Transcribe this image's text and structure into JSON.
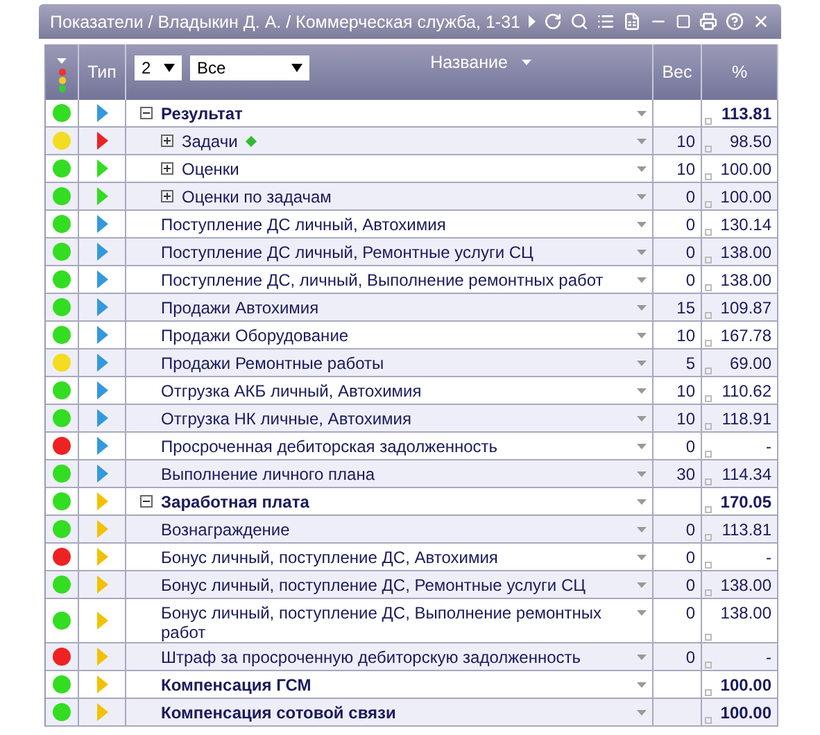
{
  "window": {
    "title": "Показатели / Владыкин Д. А. / Коммерческая служба, 1-31"
  },
  "header": {
    "type_label": "Тип",
    "level_select": "2",
    "filter_select": "Все",
    "name_label": "Название",
    "weight_label": "Вес",
    "percent_label": "%"
  },
  "rows": [
    {
      "kind": "group",
      "name": "Результат",
      "light": {
        "color": "#33dd22"
      },
      "type": {
        "color": "#3399dd"
      },
      "expanded": true,
      "marker": false,
      "percent": "113.81",
      "children": [
        {
          "kind": "item",
          "name": "Задачи",
          "light": {
            "color": "#f2dd22"
          },
          "type": {
            "color": "#ee2222"
          },
          "expanded": false,
          "marker": true,
          "weight": "10",
          "percent": "98.50"
        },
        {
          "kind": "item",
          "name": "Оценки",
          "light": {
            "color": "#33dd22"
          },
          "type": {
            "color": "#33dd22"
          },
          "expanded": false,
          "marker": false,
          "weight": "10",
          "percent": "100.00"
        },
        {
          "kind": "item",
          "name": "Оценки по задачам",
          "light": {
            "color": "#33dd22"
          },
          "type": {
            "color": "#33dd22"
          },
          "expanded": false,
          "marker": false,
          "weight": "0",
          "percent": "100.00"
        }
      ]
    },
    {
      "kind": "item",
      "name": "Поступление ДС личный, Автохимия",
      "light": {
        "color": "#33dd22"
      },
      "type": {
        "color": "#3399dd"
      },
      "marker": false,
      "weight": "0",
      "percent": "130.14"
    },
    {
      "kind": "item",
      "name": "Поступление ДС личный, Ремонтные услуги СЦ",
      "light": {
        "color": "#33dd22"
      },
      "type": {
        "color": "#3399dd"
      },
      "marker": false,
      "weight": "0",
      "percent": "138.00"
    },
    {
      "kind": "item",
      "name": "Поступление ДС, личный, Выполнение ремонтных работ",
      "light": {
        "color": "#33dd22"
      },
      "type": {
        "color": "#3399dd"
      },
      "marker": false,
      "weight": "0",
      "percent": "138.00"
    },
    {
      "kind": "item",
      "name": "Продажи Автохимия",
      "light": {
        "color": "#33dd22"
      },
      "type": {
        "color": "#3399dd"
      },
      "marker": false,
      "weight": "15",
      "percent": "109.87"
    },
    {
      "kind": "item",
      "name": "Продажи Оборудование",
      "light": {
        "color": "#33dd22"
      },
      "type": {
        "color": "#3399dd"
      },
      "marker": false,
      "weight": "10",
      "percent": "167.78"
    },
    {
      "kind": "item",
      "name": "Продажи Ремонтные работы",
      "light": {
        "color": "#f2dd22"
      },
      "type": {
        "color": "#3399dd"
      },
      "marker": false,
      "weight": "5",
      "percent": "69.00"
    },
    {
      "kind": "item",
      "name": "Отгрузка АКБ личный, Автохимия",
      "light": {
        "color": "#33dd22"
      },
      "type": {
        "color": "#3399dd"
      },
      "marker": false,
      "weight": "10",
      "percent": "110.62"
    },
    {
      "kind": "item",
      "name": "Отгрузка НК личные, Автохимия",
      "light": {
        "color": "#33dd22"
      },
      "type": {
        "color": "#3399dd"
      },
      "marker": false,
      "weight": "10",
      "percent": "118.91"
    },
    {
      "kind": "item",
      "name": "Просроченная дебиторская задолженность",
      "light": {
        "color": "#ee2222"
      },
      "type": {
        "color": "#3399dd"
      },
      "marker": false,
      "weight": "0",
      "percent": "-"
    },
    {
      "kind": "item",
      "name": "Выполнение личного плана",
      "light": {
        "color": "#33dd22"
      },
      "type": {
        "color": "#3399dd"
      },
      "marker": false,
      "weight": "30",
      "percent": "114.34"
    },
    {
      "kind": "group",
      "name": "Заработная плата",
      "light": {
        "color": "#33dd22"
      },
      "type": {
        "color": "#f2c200"
      },
      "expanded": true,
      "marker": false,
      "percent": "170.05"
    },
    {
      "kind": "item",
      "name": "Вознаграждение",
      "light": {
        "color": "#33dd22"
      },
      "type": {
        "color": "#f2c200"
      },
      "marker": false,
      "weight": "0",
      "percent": "113.81"
    },
    {
      "kind": "item",
      "name": "Бонус личный, поступление ДС, Автохимия",
      "light": {
        "color": "#ee2222"
      },
      "type": {
        "color": "#f2c200"
      },
      "marker": false,
      "weight": "0",
      "percent": "-"
    },
    {
      "kind": "item",
      "name": "Бонус личный, поступление ДС, Ремонтные услуги СЦ",
      "light": {
        "color": "#33dd22"
      },
      "type": {
        "color": "#f2c200"
      },
      "marker": false,
      "weight": "0",
      "percent": "138.00"
    },
    {
      "kind": "item",
      "name": "Бонус личный, поступление ДС, Выполнение ремонтных\nработ",
      "light": {
        "color": "#33dd22"
      },
      "type": {
        "color": "#f2c200"
      },
      "marker": false,
      "weight": "0",
      "percent": "138.00"
    },
    {
      "kind": "item",
      "name": "Штраф за просроченную дебиторскую задолженность",
      "light": {
        "color": "#ee2222"
      },
      "type": {
        "color": "#f2c200"
      },
      "marker": false,
      "weight": "0",
      "percent": "-"
    },
    {
      "kind": "group",
      "name": "Компенсация ГСМ",
      "light": {
        "color": "#33dd22"
      },
      "type": {
        "color": "#f2c200"
      },
      "marker": false,
      "percent": "100.00"
    },
    {
      "kind": "group",
      "name": "Компенсация сотовой связи",
      "light": {
        "color": "#33dd22"
      },
      "type": {
        "color": "#f2c200"
      },
      "marker": false,
      "percent": "100.00"
    }
  ]
}
